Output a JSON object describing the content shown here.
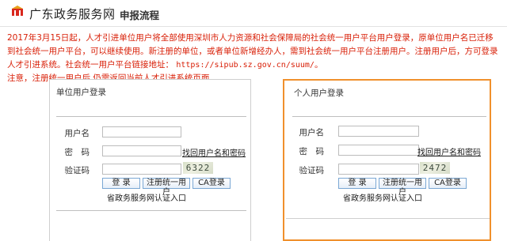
{
  "header": {
    "site_title": "广东政务服务网",
    "section_title": "申报流程"
  },
  "notice": {
    "line1": "2017年3月15日起，人才引进单位用户将全部使用深圳市人力资源和社会保障局的社会统一用户平台用户登录，原单位用户名已迁移到社会统一用户平台，可以继续使用。新注册的单位，或者单位新增经办人，需到社会统一用户平台注册用户。注册用户后，方可登录人才引进系统。社会统一用户平台链接地址：",
    "url": "https://sipub.sz.gov.cn/suum/",
    "url_tail": "。",
    "line2": "注意，注册统一用户后,仍需返回当前人才引进系统页面。"
  },
  "unit_login": {
    "title": "单位用户登录",
    "username_label": "用户名",
    "username_value": "",
    "password_label": "密　码",
    "password_value": "",
    "recover_link": "找回用户名和密码",
    "captcha_label": "验证码",
    "captcha_value": "",
    "captcha_text": "6322",
    "login_button": "登 录",
    "register_button": "注册统一用户",
    "ca_button": "CA登录",
    "portal_link": "省政务服务网认证入口"
  },
  "personal_login": {
    "title": "个人用户登录",
    "username_label": "用户名",
    "username_value": "",
    "password_label": "密　码",
    "password_value": "",
    "recover_link": "找回用户名和密码",
    "captcha_label": "验证码",
    "captcha_value": "",
    "captcha_text": "2472",
    "login_button": "登 录",
    "register_button": "注册统一用户",
    "ca_button": "CA登录",
    "portal_link": "省政务服务网认证入口"
  },
  "colors": {
    "notice": "#d81e06",
    "highlight_border": "#f0902c",
    "button_border": "#7aa7d4"
  }
}
